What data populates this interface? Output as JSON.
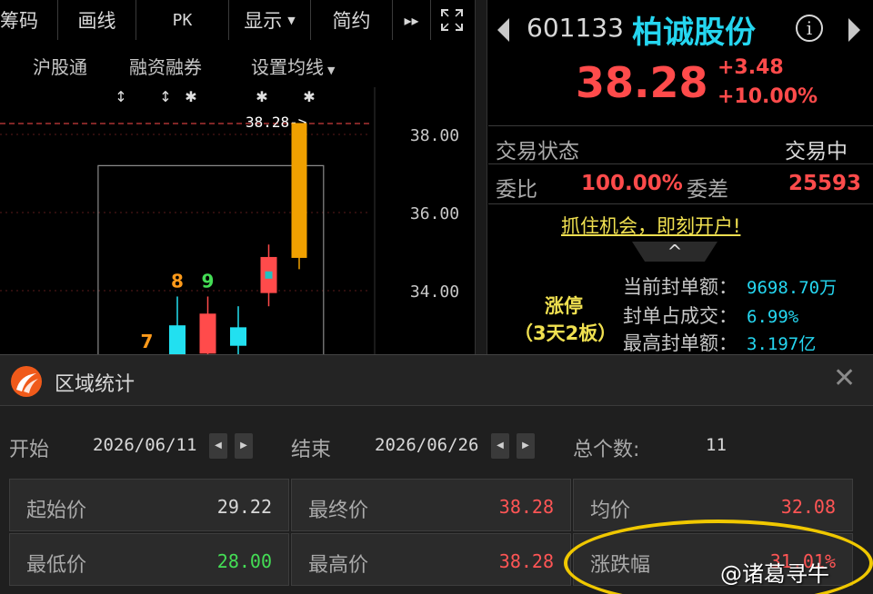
{
  "toolbar": {
    "items": [
      "筹码",
      "画线",
      "PK",
      "显示",
      "简约"
    ],
    "more_glyph": "▸▸",
    "fullscreen_glyph": "⛶"
  },
  "subtabs": [
    "沪股通",
    "融资融券",
    "设置均线"
  ],
  "chart_data": {
    "type": "candlestick",
    "x": [
      1,
      2,
      3,
      4,
      5,
      6,
      7
    ],
    "y_axis_ticks": [
      "38.00",
      "36.00",
      "34.00"
    ],
    "ylim": [
      28.0,
      39.0
    ],
    "current_price_label": "38.28",
    "current_price_arrow": "38.28->",
    "current_price": 38.28,
    "candles": [
      {
        "open": 32.3,
        "close": 32.3,
        "high": 32.3,
        "low": 32.3,
        "color": "#ff9a1a"
      },
      {
        "open": 32.3,
        "close": 32.3,
        "high": 32.3,
        "low": 32.3,
        "color": "#ff9a1a"
      },
      {
        "open": 32.3,
        "close": 33.1,
        "high": 33.85,
        "low": 32.3,
        "color": "#22e0f0"
      },
      {
        "open": 32.4,
        "close": 33.4,
        "high": 33.85,
        "low": 32.3,
        "color": "#ff4b4b"
      },
      {
        "open": 32.6,
        "close": 33.05,
        "high": 33.6,
        "low": 32.3,
        "color": "#22e0f0"
      },
      {
        "open": 34.85,
        "close": 33.95,
        "high": 35.18,
        "low": 33.6,
        "color": "#ff4b4b"
      },
      {
        "open": 38.28,
        "close": 34.85,
        "high": 38.28,
        "low": 34.55,
        "color": "#f0a000"
      }
    ],
    "annotations": [
      {
        "candle": 1,
        "text": "7",
        "color": "#ff9a1a"
      },
      {
        "candle": 2,
        "text": "8",
        "color": "#ff9a1a"
      },
      {
        "candle": 3,
        "text": "9",
        "color": "#44dd55"
      }
    ]
  },
  "quote": {
    "code": "601133",
    "name": "柏诚股份",
    "info_glyph": "i",
    "price": "38.28",
    "change": "+3.48",
    "change_pct": "+10.00%",
    "status_label": "交易状态",
    "status_value": "交易中",
    "ratio_label": "委比",
    "ratio_value": "100.00%",
    "diff_label": "委差",
    "diff_value": "25593",
    "promo": "抓住机会，即刻开户!",
    "collapse_glyph": "^",
    "limit_title": "涨停",
    "limit_sub": "（3天2板）",
    "stats": [
      {
        "label": "当前封单额：",
        "value": "9698.70万"
      },
      {
        "label": "封单占成交：",
        "value": "6.99%"
      },
      {
        "label": "最高封单额：",
        "value": "3.197亿"
      }
    ]
  },
  "dialog": {
    "title": "区域统计",
    "close_glyph": "✕",
    "start_label": "开始",
    "start_date": "2026/06/11",
    "end_label": "结束",
    "end_date": "2026/06/26",
    "count_label": "总个数:",
    "count_value": "11",
    "stepper_left": "◀",
    "stepper_right": "▶",
    "cells": [
      {
        "label": "起始价",
        "value": "29.22",
        "tone": "white"
      },
      {
        "label": "最终价",
        "value": "38.28",
        "tone": "red"
      },
      {
        "label": "均价",
        "value": "32.08",
        "tone": "red"
      },
      {
        "label": "最低价",
        "value": "28.00",
        "tone": "green"
      },
      {
        "label": "最高价",
        "value": "38.28",
        "tone": "red"
      },
      {
        "label": "涨跌幅",
        "value": "31.01%",
        "tone": "red"
      }
    ]
  },
  "watermark": "@诸葛寻牛",
  "colors": {
    "up": "#ff4b4b",
    "down": "#22e0f0",
    "accent_cyan": "#25d6f0",
    "highlight": "#f0c800",
    "green": "#44dd55"
  }
}
